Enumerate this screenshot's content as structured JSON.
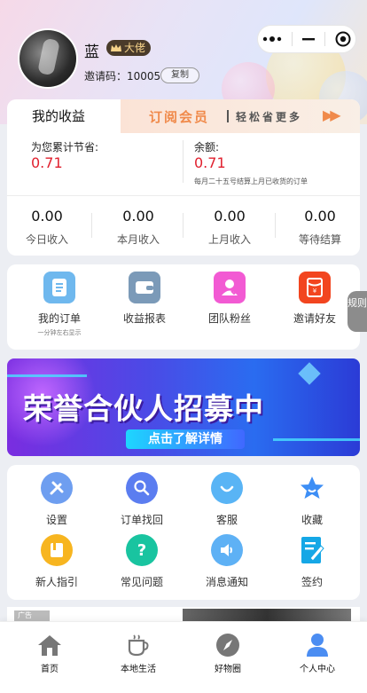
{
  "user": {
    "name": "蓝",
    "level_badge": "大佬",
    "invite_label": "邀请码：",
    "invite_code": "10005",
    "copy_label": "复制"
  },
  "earnings": {
    "tab_label": "我的收益",
    "vip_text": "订阅会员",
    "vip_slogan": "轻松省更多",
    "vip_arrow": "▶▶",
    "saved_label": "为您累计节省:",
    "saved_value": "0.71",
    "balance_label": "余额:",
    "balance_value": "0.71",
    "balance_note": "每月二十五号结算上月已收货的订单",
    "stats": [
      {
        "value": "0.00",
        "label": "今日收入"
      },
      {
        "value": "0.00",
        "label": "本月收入"
      },
      {
        "value": "0.00",
        "label": "上月收入"
      },
      {
        "value": "0.00",
        "label": "等待结算"
      }
    ]
  },
  "quick_links": [
    {
      "label": "我的订单",
      "sub": "一分钟左右显示",
      "icon": "order-list-icon",
      "color": "#6fb8ee"
    },
    {
      "label": "收益报表",
      "sub": "",
      "icon": "wallet-icon",
      "color": "#7b9ab8"
    },
    {
      "label": "团队粉丝",
      "sub": "",
      "icon": "team-fans-icon",
      "color": "#f25ad3"
    },
    {
      "label": "邀请好友",
      "sub": "",
      "icon": "red-envelope-icon",
      "color": "#f2451f"
    }
  ],
  "rules_tab": "规则",
  "banner": {
    "title": "荣誉合伙人招募中",
    "button": "点击了解详情"
  },
  "tools": [
    {
      "label": "设置",
      "icon": "tools-icon",
      "color": "#6e9ef0"
    },
    {
      "label": "订单找回",
      "icon": "search-icon",
      "color": "#5b7df0"
    },
    {
      "label": "客服",
      "icon": "customer-service-icon",
      "color": "#59b4f5"
    },
    {
      "label": "收藏",
      "icon": "star-icon",
      "color": "#3d8ef5"
    },
    {
      "label": "新人指引",
      "icon": "guide-book-icon",
      "color": "#f7b520"
    },
    {
      "label": "常见问题",
      "icon": "question-icon",
      "color": "#19c4a0"
    },
    {
      "label": "消息通知",
      "icon": "speaker-icon",
      "color": "#5eb1f5"
    },
    {
      "label": "签约",
      "icon": "sign-contract-icon",
      "color": "#15a7e6"
    }
  ],
  "ad": {
    "tag": "广告"
  },
  "tabbar": [
    {
      "label": "首页",
      "icon": "home-icon"
    },
    {
      "label": "本地生活",
      "icon": "coffee-cup-icon"
    },
    {
      "label": "好物圈",
      "icon": "compass-icon"
    },
    {
      "label": "个人中心",
      "icon": "person-icon"
    }
  ]
}
